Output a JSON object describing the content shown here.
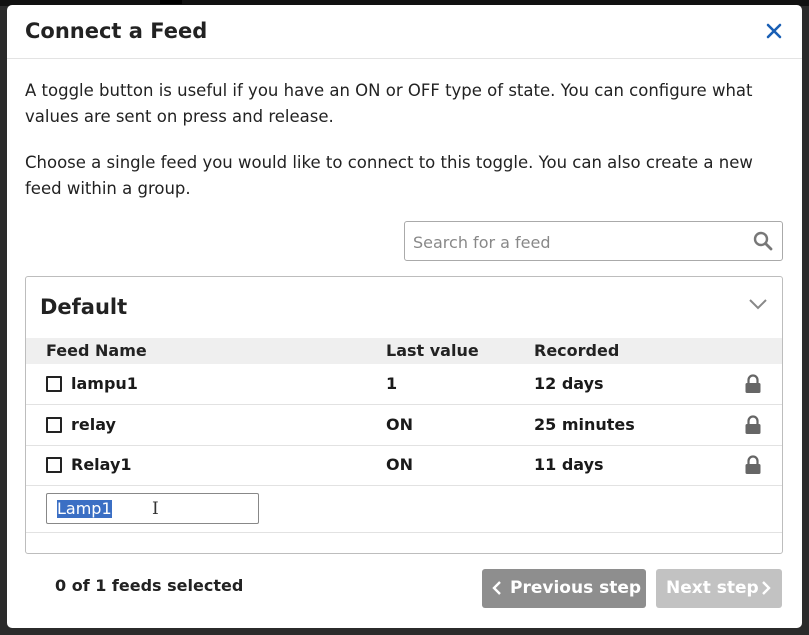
{
  "modal": {
    "title": "Connect a Feed",
    "close_icon": "close-icon",
    "intro_text": "A toggle button is useful if you have an ON or OFF type of state. You can configure what values are sent on press and release.",
    "instruction_text": "Choose a single feed you would like to connect to this toggle. You can also create a new feed within a group."
  },
  "search": {
    "placeholder": "Search for a feed",
    "value": "",
    "icon": "search-icon"
  },
  "group": {
    "title": "Default",
    "columns": {
      "name": "Feed Name",
      "last_value": "Last value",
      "recorded": "Recorded"
    },
    "feeds": [
      {
        "name": "lampu1",
        "last_value": "1",
        "recorded": "12 days",
        "checked": false,
        "icon": "lock-icon"
      },
      {
        "name": "relay",
        "last_value": "ON",
        "recorded": "25 minutes",
        "checked": false,
        "icon": "lock-icon"
      },
      {
        "name": "Relay1",
        "last_value": "ON",
        "recorded": "11 days",
        "checked": false,
        "icon": "lock-icon"
      }
    ],
    "new_feed_value": "Lamp1"
  },
  "footer": {
    "status": "0 of 1 feeds selected",
    "prev_label": "Previous step",
    "next_label": "Next step"
  },
  "colors": {
    "accent": "#1a5fb4",
    "prev_button": "#8e8e8e",
    "next_button_disabled": "#c2c2c2",
    "selection": "#3b6fc4"
  }
}
